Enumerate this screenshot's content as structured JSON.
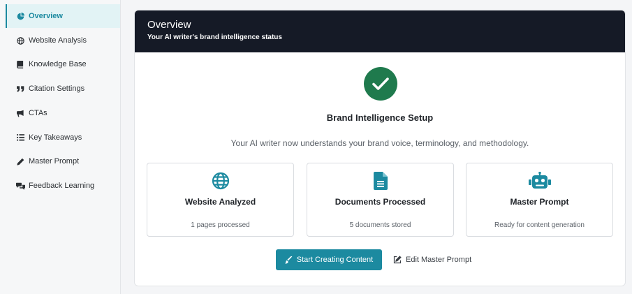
{
  "sidebar": {
    "items": [
      {
        "label": "Overview",
        "icon": "pie-chart-icon",
        "active": true
      },
      {
        "label": "Website Analysis",
        "icon": "globe-icon"
      },
      {
        "label": "Knowledge Base",
        "icon": "book-icon"
      },
      {
        "label": "Citation Settings",
        "icon": "quote-icon"
      },
      {
        "label": "CTAs",
        "icon": "megaphone-icon"
      },
      {
        "label": "Key Takeaways",
        "icon": "list-icon"
      },
      {
        "label": "Master Prompt",
        "icon": "pencil-icon"
      },
      {
        "label": "Feedback Learning",
        "icon": "comments-icon"
      }
    ]
  },
  "overview": {
    "title": "Overview",
    "subtitle": "Your AI writer's brand intelligence status",
    "setup_title": "Brand Intelligence Setup",
    "setup_description": "Your AI writer now understands your brand voice, terminology, and methodology.",
    "status_icon": "check-circle-icon"
  },
  "stats": [
    {
      "label": "Website Analyzed",
      "detail": "1 pages processed",
      "icon": "globe-icon"
    },
    {
      "label": "Documents Processed",
      "detail": "5 documents stored",
      "icon": "document-icon"
    },
    {
      "label": "Master Prompt",
      "detail": "Ready for content generation",
      "icon": "robot-icon"
    }
  ],
  "actions": {
    "primary_label": "Start Creating Content",
    "secondary_label": "Edit Master Prompt"
  },
  "colors": {
    "accent": "#1c8aa0",
    "header_bg": "#151a26",
    "success": "#1f7a4d"
  }
}
